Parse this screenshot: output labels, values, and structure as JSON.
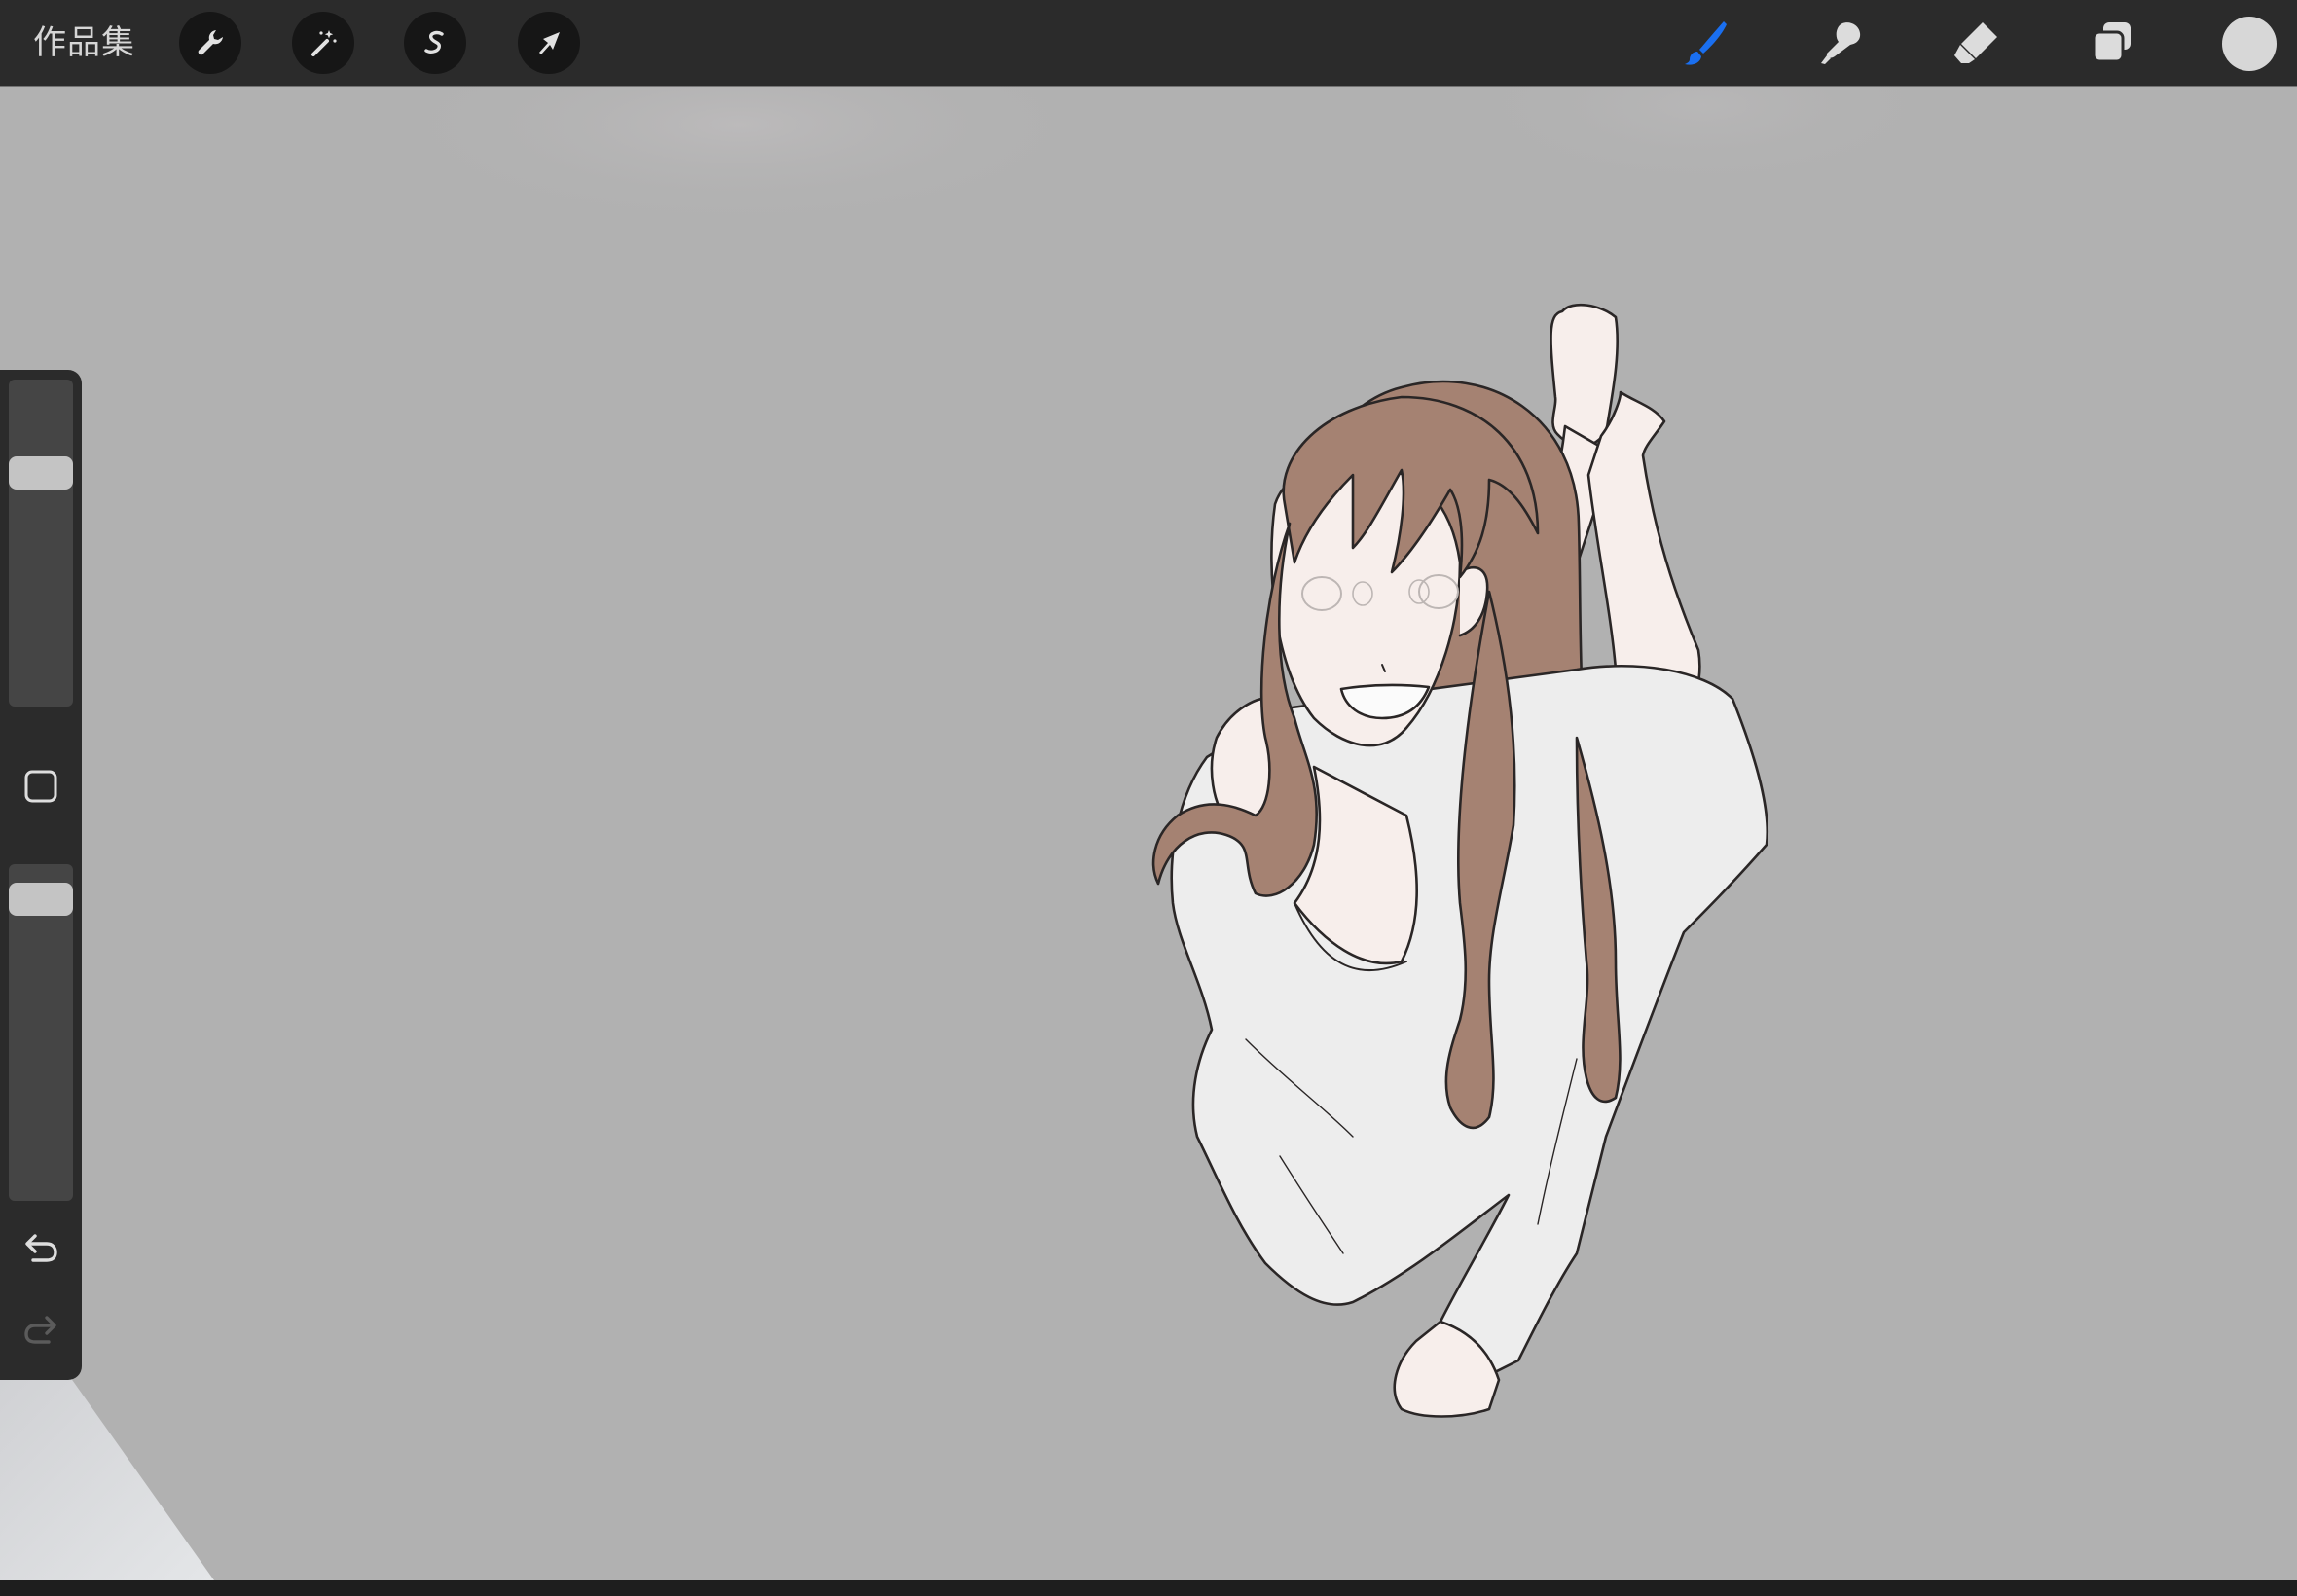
{
  "topbar": {
    "gallery_label": "作品集",
    "left_tools": [
      {
        "name": "actions",
        "icon": "wrench-icon"
      },
      {
        "name": "adjustments",
        "icon": "magic-wand-icon"
      },
      {
        "name": "selection",
        "icon": "selection-s-icon"
      },
      {
        "name": "transform",
        "icon": "arrow-cursor-icon"
      }
    ],
    "right_tools": [
      {
        "name": "brush",
        "icon": "brush-icon",
        "active": true
      },
      {
        "name": "smudge",
        "icon": "smudge-finger-icon",
        "active": false
      },
      {
        "name": "eraser",
        "icon": "eraser-icon",
        "active": false
      },
      {
        "name": "layers",
        "icon": "layers-icon",
        "active": false
      }
    ],
    "current_color": "#d7d7d7"
  },
  "sidebar": {
    "brush_size_level": 0.26,
    "opacity_level": 0.06,
    "modify_icon": "square-modify-icon",
    "undo_icon": "undo-arrow-icon",
    "redo_icon": "redo-arrow-icon",
    "redo_enabled": false
  },
  "colors": {
    "toolbar_bg": "#2b2b2b",
    "canvas_bg": "#b1b1b1",
    "active_tool_accent": "#1a6ff0",
    "hair": "#a58272",
    "skin": "#f7eeeb",
    "shirt": "#ededed"
  }
}
